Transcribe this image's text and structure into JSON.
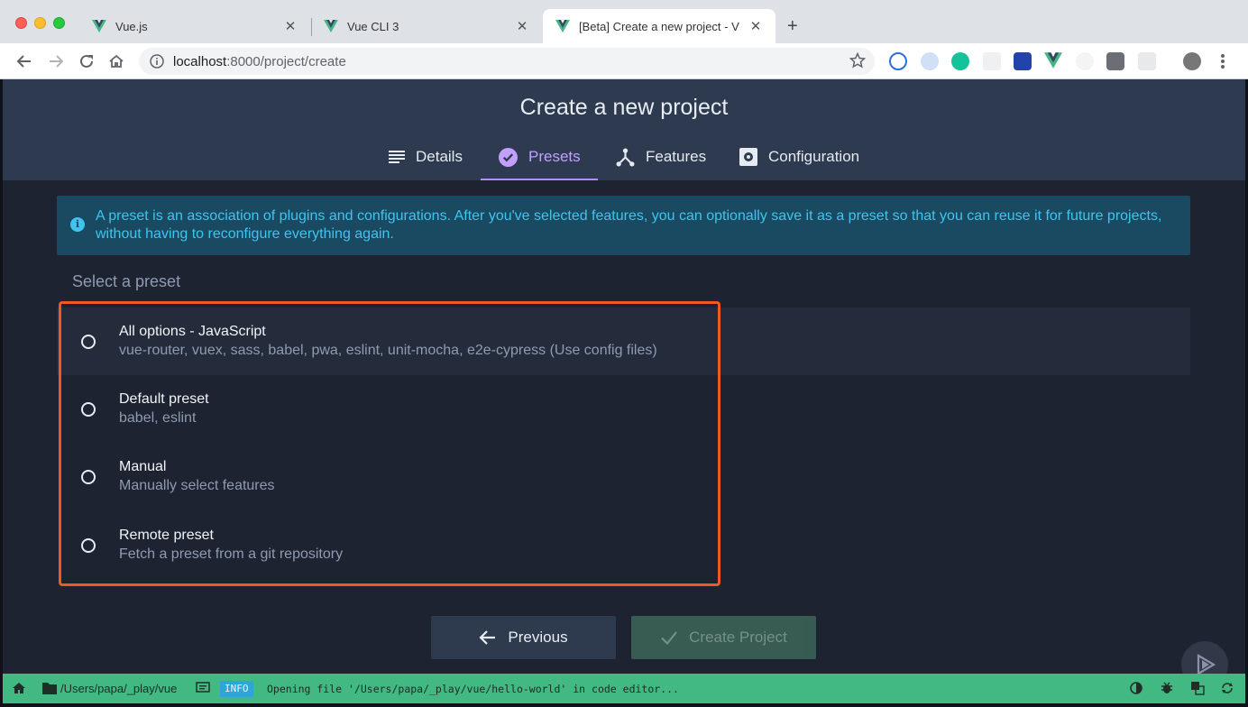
{
  "browser": {
    "tabs": [
      {
        "title": "Vue.js",
        "active": false
      },
      {
        "title": "Vue CLI 3",
        "active": false
      },
      {
        "title": "[Beta] Create a new project - V",
        "active": true
      }
    ],
    "url_host": "localhost",
    "url_path": ":8000/project/create"
  },
  "app": {
    "title": "Create a new project",
    "steps": [
      {
        "label": "Details",
        "icon": "list-icon"
      },
      {
        "label": "Presets",
        "icon": "check-circle-icon",
        "active": true
      },
      {
        "label": "Features",
        "icon": "fork-icon"
      },
      {
        "label": "Configuration",
        "icon": "gear-box-icon"
      }
    ],
    "info": "A preset is an association of plugins and configurations. After you've selected features, you can optionally save it as a preset so that you can reuse it for future projects, without having to reconfigure everything again.",
    "section_label": "Select a preset",
    "presets": [
      {
        "name": "All options - JavaScript",
        "description": "vue-router, vuex, sass, babel, pwa, eslint, unit-mocha, e2e-cypress (Use config files)"
      },
      {
        "name": "Default preset",
        "description": "babel, eslint"
      },
      {
        "name": "Manual",
        "description": "Manually select features"
      },
      {
        "name": "Remote preset",
        "description": "Fetch a preset from a git repository"
      }
    ],
    "buttons": {
      "previous": "Previous",
      "create": "Create Project"
    }
  },
  "statusbar": {
    "path": "/Users/papa/_play/vue",
    "badge": "INFO",
    "message": "Opening file '/Users/papa/_play/vue/hello-world' in code editor..."
  },
  "colors": {
    "accent": "#42b983",
    "step_active": "#c3a0ff",
    "info_text": "#3ec4ef",
    "highlight": "#f05a22"
  }
}
